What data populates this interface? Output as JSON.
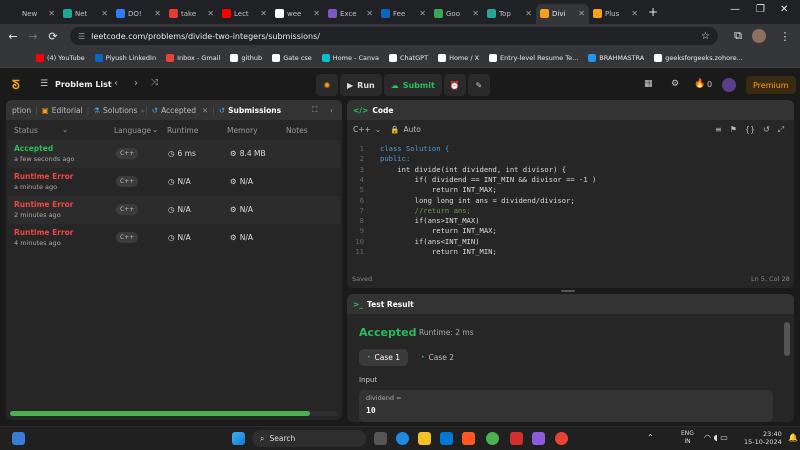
{
  "browser": {
    "tabs": [
      {
        "label": "New",
        "color": "#202124"
      },
      {
        "label": "Net",
        "color": "#1fa896"
      },
      {
        "label": "DO!",
        "color": "#2d7ff9"
      },
      {
        "label": "take",
        "color": "#e53935"
      },
      {
        "label": "Lect",
        "color": "#ff0000"
      },
      {
        "label": "wee",
        "color": "#ffffff"
      },
      {
        "label": "Exce",
        "color": "#7e57c2"
      },
      {
        "label": "Fee",
        "color": "#0a66c2"
      },
      {
        "label": "Goo",
        "color": "#34a853"
      },
      {
        "label": "Top",
        "color": "#26a69a"
      },
      {
        "label": "Divi",
        "color": "#f89f1b",
        "active": true
      },
      {
        "label": "Plus",
        "color": "#f89f1b"
      }
    ],
    "url": "leetcode.com/problems/divide-two-integers/submissions/",
    "bookmarks": [
      {
        "label": "(4) YouTube",
        "color": "#ff0000"
      },
      {
        "label": "Piyush LinkedIn",
        "color": "#0a66c2"
      },
      {
        "label": "Inbox - Gmail",
        "color": "#ea4335"
      },
      {
        "label": "github",
        "color": "#ffffff"
      },
      {
        "label": "Gate cse",
        "color": "#ffffff"
      },
      {
        "label": "Home - Canva",
        "color": "#00c4cc"
      },
      {
        "label": "ChatGPT",
        "color": "#ffffff"
      },
      {
        "label": "Home / X",
        "color": "#ffffff"
      },
      {
        "label": "Entry-level Resume Te...",
        "color": "#ffffff"
      },
      {
        "label": "BRAHMASTRA",
        "color": "#2196f3"
      },
      {
        "label": "geeksforgeeks.zohore...",
        "color": "#ffffff"
      }
    ]
  },
  "lc_nav": {
    "problem_list": "Problem List",
    "run": "Run",
    "submit": "Submit",
    "streak": "0",
    "premium": "Premium"
  },
  "left_panel": {
    "tabs": [
      "ption",
      "Editorial",
      "Solutions",
      "Accepted",
      "Submissions"
    ],
    "columns": [
      "Status",
      "Language",
      "Runtime",
      "Memory",
      "Notes"
    ],
    "rows": [
      {
        "status": "Accepted",
        "when": "a few seconds ago",
        "lang": "C++",
        "runtime": "6 ms",
        "memory": "8.4 MB",
        "color": "#2cbb5d"
      },
      {
        "status": "Runtime Error",
        "when": "a minute ago",
        "lang": "C++",
        "runtime": "N/A",
        "memory": "N/A",
        "color": "#ef4743"
      },
      {
        "status": "Runtime Error",
        "when": "2 minutes ago",
        "lang": "C++",
        "runtime": "N/A",
        "memory": "N/A",
        "color": "#ef4743"
      },
      {
        "status": "Runtime Error",
        "when": "4 minutes ago",
        "lang": "C++",
        "runtime": "N/A",
        "memory": "N/A",
        "color": "#ef4743"
      }
    ]
  },
  "code_panel": {
    "title": "Code",
    "language": "C++",
    "mode": "Auto",
    "lines": [
      {
        "n": "1",
        "html": "class Solution {"
      },
      {
        "n": "2",
        "html": "public:"
      },
      {
        "n": "3",
        "html": "    int divide(int dividend, int divisor) {"
      },
      {
        "n": "4",
        "html": "        if( dividend == INT_MIN && divisor == -1 )"
      },
      {
        "n": "5",
        "html": "            return INT_MAX;"
      },
      {
        "n": "6",
        "html": "        long long int ans = dividend/divisor;"
      },
      {
        "n": "7",
        "html": "        //return ans;"
      },
      {
        "n": "8",
        "html": "        if(ans>INT_MAX)"
      },
      {
        "n": "9",
        "html": "            return INT_MAX;"
      },
      {
        "n": "10",
        "html": "        if(ans<INT_MIN)"
      },
      {
        "n": "11",
        "html": "            return INT_MIN;"
      }
    ],
    "saved": "Saved",
    "cursor": "Ln 5, Col 28"
  },
  "result_panel": {
    "title": "Test Result",
    "verdict": "Accepted",
    "runtime": "Runtime: 2 ms",
    "cases": [
      "Case 1",
      "Case 2"
    ],
    "input_label": "Input",
    "var_name": "dividend =",
    "var_value": "10"
  },
  "taskbar": {
    "search": "Search",
    "lang1": "ENG",
    "lang2": "IN",
    "time": "23:40",
    "date": "15-10-2024"
  }
}
